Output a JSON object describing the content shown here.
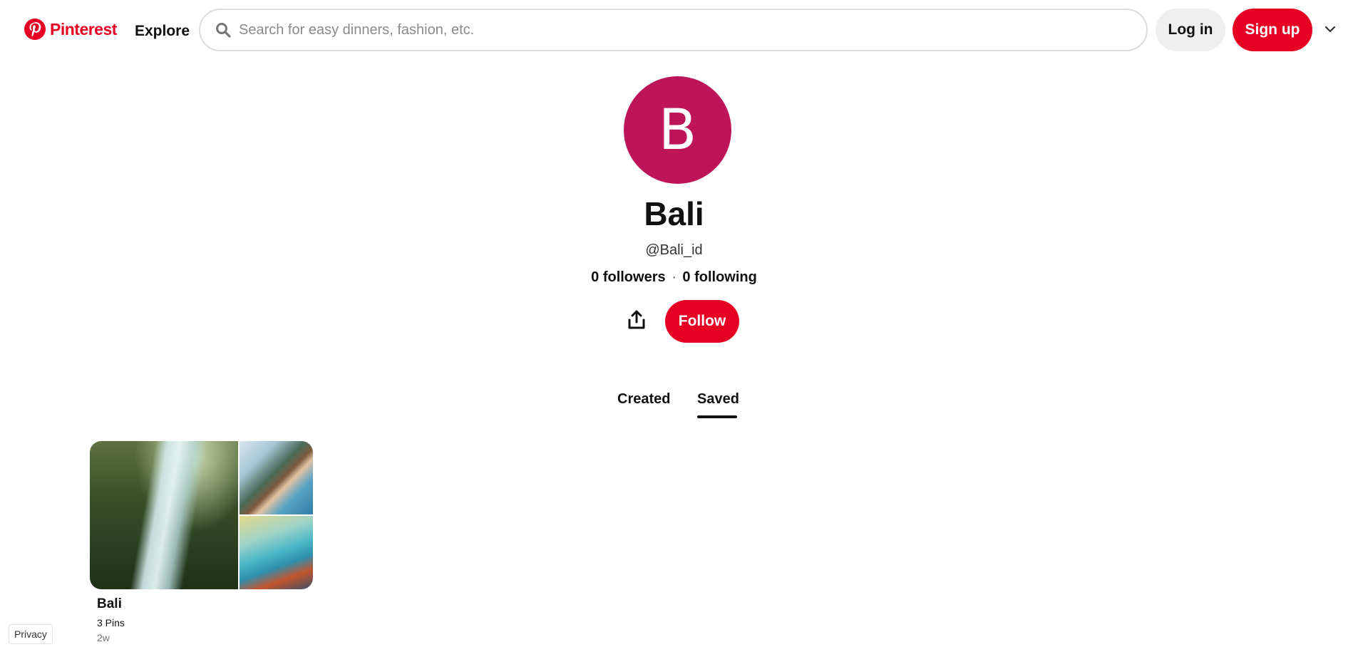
{
  "header": {
    "logo_text": "Pinterest",
    "explore_label": "Explore",
    "search_placeholder": "Search for easy dinners, fashion, etc.",
    "login_label": "Log in",
    "signup_label": "Sign up",
    "brand_color": "#e60023"
  },
  "profile": {
    "avatar_letter": "B",
    "avatar_color": "#bd1557",
    "name": "Bali",
    "handle": "@Bali_id",
    "followers": "0 followers",
    "separator": "·",
    "following": "0 following",
    "follow_label": "Follow"
  },
  "tabs": [
    {
      "label": "Created",
      "active": false
    },
    {
      "label": "Saved",
      "active": true
    }
  ],
  "boards": [
    {
      "title": "Bali",
      "pins": "3 Pins",
      "age": "2w"
    }
  ],
  "footer": {
    "privacy_label": "Privacy"
  }
}
